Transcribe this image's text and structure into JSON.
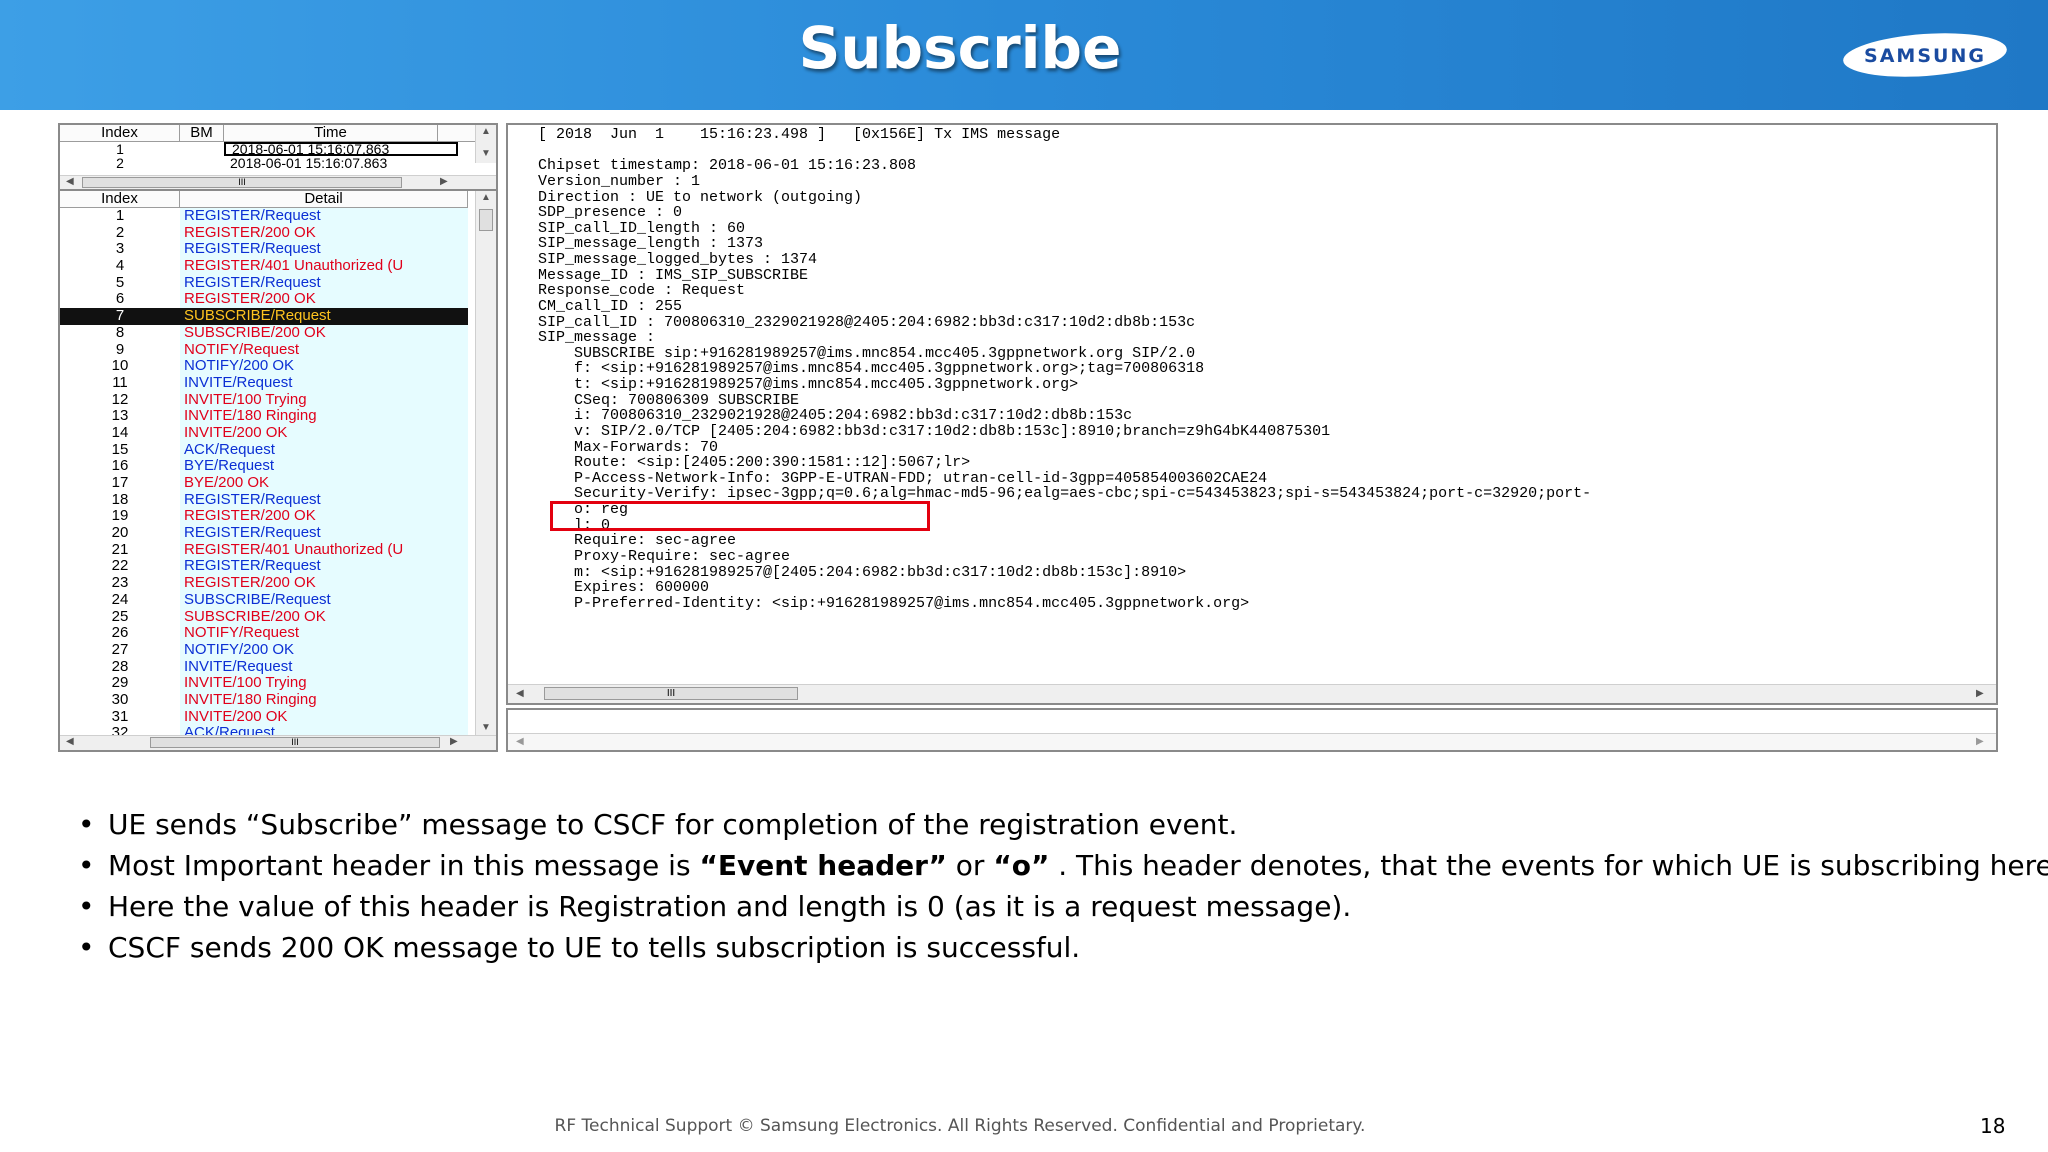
{
  "slide": {
    "title": "Subscribe",
    "logo_text": "SAMSUNG",
    "footer": "RF Technical Support © Samsung Electronics. All Rights Reserved. Confidential and Proprietary.",
    "page_number": "18"
  },
  "bookmark_table": {
    "headers": [
      "Index",
      "BM",
      "Time"
    ],
    "rows": [
      {
        "index": "1",
        "bm": "",
        "time": "2018-06-01 15:16:07.863"
      },
      {
        "index": "2",
        "bm": "",
        "time": "2018-06-01 15:16:07.863"
      }
    ]
  },
  "message_list": {
    "headers": [
      "Index",
      "Detail"
    ],
    "items": [
      {
        "index": "1",
        "detail": "REGISTER/Request",
        "color": "#0b2fd4"
      },
      {
        "index": "2",
        "detail": "REGISTER/200 OK",
        "color": "#e0001b"
      },
      {
        "index": "3",
        "detail": "REGISTER/Request",
        "color": "#0b2fd4"
      },
      {
        "index": "4",
        "detail": "REGISTER/401 Unauthorized (U",
        "color": "#e0001b"
      },
      {
        "index": "5",
        "detail": "REGISTER/Request",
        "color": "#0b2fd4"
      },
      {
        "index": "6",
        "detail": "REGISTER/200 OK",
        "color": "#e0001b"
      },
      {
        "index": "7",
        "detail": "SUBSCRIBE/Request",
        "color": "#ffc41f",
        "selected": true
      },
      {
        "index": "8",
        "detail": "SUBSCRIBE/200 OK",
        "color": "#e0001b"
      },
      {
        "index": "9",
        "detail": "NOTIFY/Request",
        "color": "#e0001b"
      },
      {
        "index": "10",
        "detail": "NOTIFY/200 OK",
        "color": "#0b2fd4"
      },
      {
        "index": "11",
        "detail": "INVITE/Request",
        "color": "#0b2fd4"
      },
      {
        "index": "12",
        "detail": "INVITE/100 Trying",
        "color": "#e0001b"
      },
      {
        "index": "13",
        "detail": "INVITE/180 Ringing",
        "color": "#e0001b"
      },
      {
        "index": "14",
        "detail": "INVITE/200 OK",
        "color": "#e0001b"
      },
      {
        "index": "15",
        "detail": "ACK/Request",
        "color": "#0b2fd4"
      },
      {
        "index": "16",
        "detail": "BYE/Request",
        "color": "#0b2fd4"
      },
      {
        "index": "17",
        "detail": "BYE/200 OK",
        "color": "#e0001b"
      },
      {
        "index": "18",
        "detail": "REGISTER/Request",
        "color": "#0b2fd4"
      },
      {
        "index": "19",
        "detail": "REGISTER/200 OK",
        "color": "#e0001b"
      },
      {
        "index": "20",
        "detail": "REGISTER/Request",
        "color": "#0b2fd4"
      },
      {
        "index": "21",
        "detail": "REGISTER/401 Unauthorized (U",
        "color": "#e0001b"
      },
      {
        "index": "22",
        "detail": "REGISTER/Request",
        "color": "#0b2fd4"
      },
      {
        "index": "23",
        "detail": "REGISTER/200 OK",
        "color": "#e0001b"
      },
      {
        "index": "24",
        "detail": "SUBSCRIBE/Request",
        "color": "#0b2fd4"
      },
      {
        "index": "25",
        "detail": "SUBSCRIBE/200 OK",
        "color": "#e0001b"
      },
      {
        "index": "26",
        "detail": "NOTIFY/Request",
        "color": "#e0001b"
      },
      {
        "index": "27",
        "detail": "NOTIFY/200 OK",
        "color": "#0b2fd4"
      },
      {
        "index": "28",
        "detail": "INVITE/Request",
        "color": "#0b2fd4"
      },
      {
        "index": "29",
        "detail": "INVITE/100 Trying",
        "color": "#e0001b"
      },
      {
        "index": "30",
        "detail": "INVITE/180 Ringing",
        "color": "#e0001b"
      },
      {
        "index": "31",
        "detail": "INVITE/200 OK",
        "color": "#e0001b"
      },
      {
        "index": "32",
        "detail": "ACK/Request",
        "color": "#0b2fd4"
      }
    ]
  },
  "log_lines": [
    "[ 2018  Jun  1    15:16:23.498 ]   [0x156E] Tx IMS message",
    "",
    "Chipset timestamp: 2018-06-01 15:16:23.808",
    "Version_number : 1",
    "Direction : UE to network (outgoing)",
    "SDP_presence : 0",
    "SIP_call_ID_length : 60",
    "SIP_message_length : 1373",
    "SIP_message_logged_bytes : 1374",
    "Message_ID : IMS_SIP_SUBSCRIBE",
    "Response_code : Request",
    "CM_call_ID : 255",
    "SIP_call_ID : 700806310_2329021928@2405:204:6982:bb3d:c317:10d2:db8b:153c",
    "SIP_message :",
    "    SUBSCRIBE sip:+916281989257@ims.mnc854.mcc405.3gppnetwork.org SIP/2.0",
    "    f: <sip:+916281989257@ims.mnc854.mcc405.3gppnetwork.org>;tag=700806318",
    "    t: <sip:+916281989257@ims.mnc854.mcc405.3gppnetwork.org>",
    "    CSeq: 700806309 SUBSCRIBE",
    "    i: 700806310_2329021928@2405:204:6982:bb3d:c317:10d2:db8b:153c",
    "    v: SIP/2.0/TCP [2405:204:6982:bb3d:c317:10d2:db8b:153c]:8910;branch=z9hG4bK440875301",
    "    Max-Forwards: 70",
    "    Route: <sip:[2405:200:390:1581::12]:5067;lr>",
    "    P-Access-Network-Info: 3GPP-E-UTRAN-FDD; utran-cell-id-3gpp=405854003602CAE24",
    "    Security-Verify: ipsec-3gpp;q=0.6;alg=hmac-md5-96;ealg=aes-cbc;spi-c=543453823;spi-s=543453824;port-c=32920;port-",
    "    o: reg",
    "    l: 0",
    "    Require: sec-agree",
    "    Proxy-Require: sec-agree",
    "    m: <sip:+916281989257@[2405:204:6982:bb3d:c317:10d2:db8b:153c]:8910>",
    "    Expires: 600000",
    "    P-Preferred-Identity: <sip:+916281989257@ims.mnc854.mcc405.3gppnetwork.org>"
  ],
  "bullets": [
    [
      {
        "t": "UE sends “Subscribe” message to CSCF for completion of the registration event."
      }
    ],
    [
      {
        "t": "Most Important header in this message is "
      },
      {
        "t": "“Event header”",
        "b": true
      },
      {
        "t": " or "
      },
      {
        "t": "“o”",
        "b": true
      },
      {
        "t": " . This header denotes, that the events for which UE is subscribing here."
      }
    ],
    [
      {
        "t": "Here the value of this header is Registration and length is 0 (as it is a request message)."
      }
    ],
    [
      {
        "t": "CSCF sends 200 OK message to UE to tells subscription is successful."
      }
    ]
  ],
  "scroll_glyph": "III"
}
